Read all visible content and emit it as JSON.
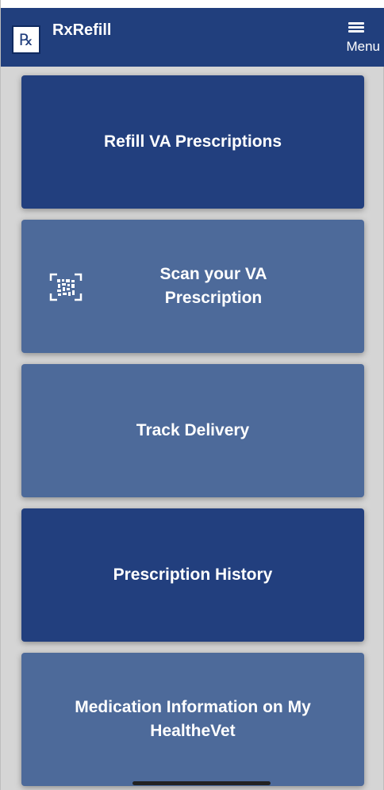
{
  "header": {
    "logo_text": "℞",
    "title": "RxRefill",
    "menu_label": "Menu"
  },
  "tiles": [
    {
      "label": "Refill VA Prescriptions",
      "style": "dark"
    },
    {
      "label": "Scan your VA Prescription",
      "style": "light",
      "icon": "barcode-scan-icon"
    },
    {
      "label": "Track Delivery",
      "style": "light"
    },
    {
      "label": "Prescription History",
      "style": "dark"
    },
    {
      "label": "Medication Information on My HealtheVet",
      "style": "light"
    }
  ],
  "colors": {
    "header": "#213f7d",
    "tile_dark": "#223f7e",
    "tile_light": "#4d6a9a",
    "background": "#d5d5d5"
  }
}
